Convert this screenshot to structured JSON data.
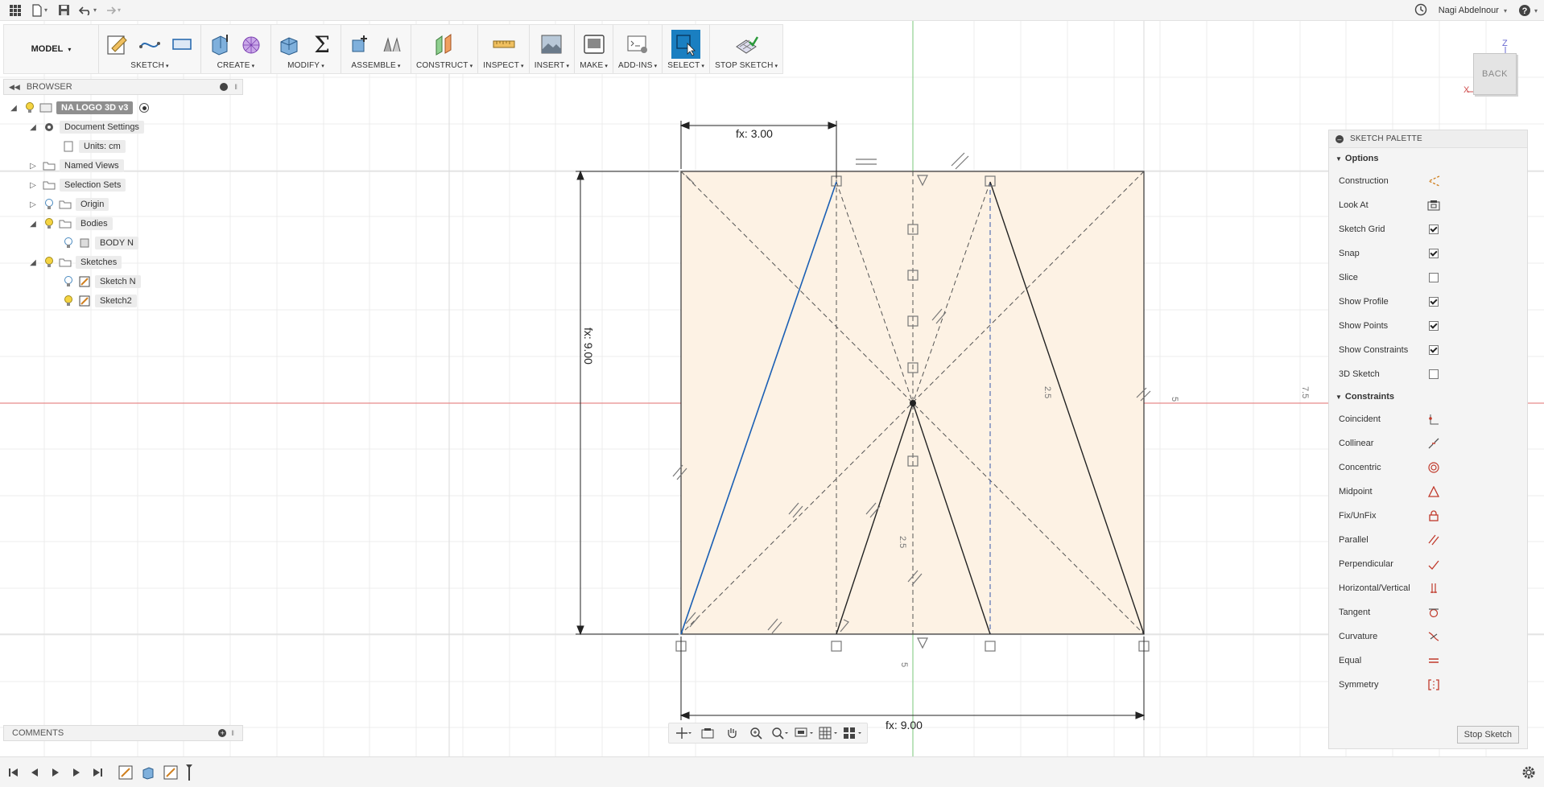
{
  "user": {
    "name": "Nagi Abdelnour"
  },
  "ribbon": {
    "workspace": "MODEL",
    "groups": [
      {
        "label": "SKETCH"
      },
      {
        "label": "CREATE"
      },
      {
        "label": "MODIFY"
      },
      {
        "label": "ASSEMBLE"
      },
      {
        "label": "CONSTRUCT"
      },
      {
        "label": "INSPECT"
      },
      {
        "label": "INSERT"
      },
      {
        "label": "MAKE"
      },
      {
        "label": "ADD-INS"
      },
      {
        "label": "SELECT"
      },
      {
        "label": "STOP SKETCH"
      }
    ]
  },
  "browser": {
    "title": "BROWSER",
    "root": "NA LOGO 3D v3",
    "items": [
      {
        "label": "Document Settings"
      },
      {
        "label": "Units: cm"
      },
      {
        "label": "Named Views"
      },
      {
        "label": "Selection Sets"
      },
      {
        "label": "Origin"
      },
      {
        "label": "Bodies"
      },
      {
        "label": "BODY N"
      },
      {
        "label": "Sketches"
      },
      {
        "label": "Sketch N"
      },
      {
        "label": "Sketch2"
      }
    ]
  },
  "comments": {
    "title": "COMMENTS"
  },
  "viewcube": {
    "face": "BACK",
    "axis_z": "Z",
    "axis_x": "X"
  },
  "sketch": {
    "dim_top": "fx: 3.00",
    "dim_left": "fx: 9.00",
    "dim_bottom": "fx: 9.00",
    "grid_labels": {
      "a": "2.5",
      "b": "5",
      "c": "7.5",
      "d": "2.5",
      "e": "5"
    }
  },
  "palette": {
    "title": "SKETCH PALETTE",
    "options_title": "Options",
    "options": [
      {
        "label": "Construction"
      },
      {
        "label": "Look At"
      },
      {
        "label": "Sketch Grid",
        "checked": true
      },
      {
        "label": "Snap",
        "checked": true
      },
      {
        "label": "Slice",
        "checked": false
      },
      {
        "label": "Show Profile",
        "checked": true
      },
      {
        "label": "Show Points",
        "checked": true
      },
      {
        "label": "Show Constraints",
        "checked": true
      },
      {
        "label": "3D Sketch",
        "checked": false
      }
    ],
    "constraints_title": "Constraints",
    "constraints": [
      {
        "label": "Coincident"
      },
      {
        "label": "Collinear"
      },
      {
        "label": "Concentric"
      },
      {
        "label": "Midpoint"
      },
      {
        "label": "Fix/UnFix"
      },
      {
        "label": "Parallel"
      },
      {
        "label": "Perpendicular"
      },
      {
        "label": "Horizontal/Vertical"
      },
      {
        "label": "Tangent"
      },
      {
        "label": "Curvature"
      },
      {
        "label": "Equal"
      },
      {
        "label": "Symmetry"
      }
    ],
    "stop_button": "Stop Sketch"
  },
  "colors": {
    "accent": "#0696d7",
    "constraint_red": "#c0392b",
    "sketch_fill": "#fdf2e4",
    "select_blue": "#1a7fc1"
  }
}
